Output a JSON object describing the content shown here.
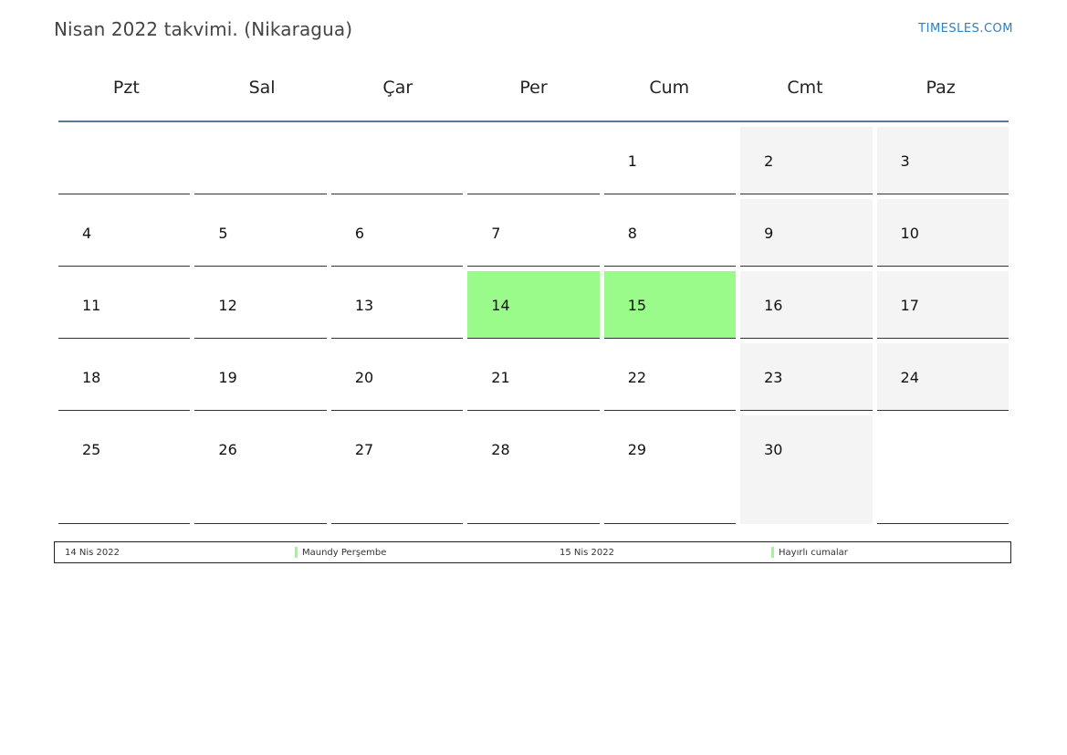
{
  "header": {
    "title": "Nisan 2022 takvimi. (Nikaragua)",
    "brand": "TIMESLES.COM"
  },
  "calendar": {
    "weekdays": [
      "Pzt",
      "Sal",
      "Çar",
      "Per",
      "Cum",
      "Cmt",
      "Paz"
    ],
    "weeks": [
      [
        "",
        "",
        "",
        "",
        "1",
        "2",
        "3"
      ],
      [
        "4",
        "5",
        "6",
        "7",
        "8",
        "9",
        "10"
      ],
      [
        "11",
        "12",
        "13",
        "14",
        "15",
        "16",
        "17"
      ],
      [
        "18",
        "19",
        "20",
        "21",
        "22",
        "23",
        "24"
      ],
      [
        "25",
        "26",
        "27",
        "28",
        "29",
        "30",
        ""
      ]
    ],
    "holiday_color": "#9afa8a",
    "weekend_color": "#f4f4f4"
  },
  "legend": {
    "holidays": [
      {
        "date": "14 Nis 2022",
        "name": "Maundy Perşembe"
      },
      {
        "date": "15 Nis 2022",
        "name": "Hayırlı cumalar"
      }
    ]
  }
}
